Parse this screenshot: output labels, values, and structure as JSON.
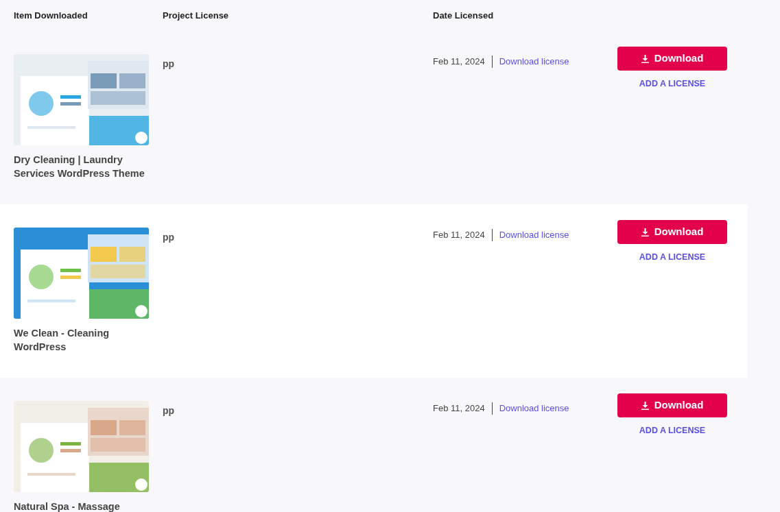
{
  "table": {
    "columns": [
      "Item Downloaded",
      "Project License",
      "Date Licensed"
    ],
    "rows": [
      {
        "item": "Dry Cleaning | Laundry Services WordPress Theme",
        "license": "pp",
        "date": "Feb 11, 2024",
        "license_link": "Download license",
        "button": "Download",
        "add_license": "ADD A LICENSE"
      },
      {
        "item": "We Clean - Cleaning WordPress",
        "license": "pp",
        "date": "Feb 11, 2024",
        "license_link": "Download license",
        "button": "Download",
        "add_license": "ADD A LICENSE"
      },
      {
        "item": "Natural Spa - Massage",
        "license": "pp",
        "date": "Feb 11, 2024",
        "license_link": "Download license",
        "button": "Download",
        "add_license": "ADD A LICENSE"
      }
    ]
  }
}
